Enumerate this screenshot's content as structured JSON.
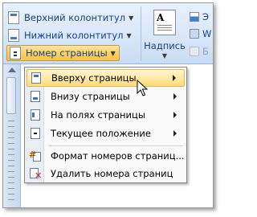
{
  "ribbon": {
    "header_button": "Верхний колонтитул",
    "footer_button": "Нижний колонтитул",
    "page_number_button": "Номер страницы",
    "textbox_label": "Надпись",
    "textbox_icon_letter": "A",
    "partial_items": [
      "Э",
      "W",
      "Б"
    ]
  },
  "menu": {
    "items": [
      {
        "label": "Вверху страницы",
        "submenu": true,
        "icon": "page-top-icon"
      },
      {
        "label": "Внизу страницы",
        "submenu": true,
        "icon": "page-bottom-icon"
      },
      {
        "label": "На полях страницы",
        "submenu": true,
        "icon": "page-margin-icon"
      },
      {
        "label": "Текущее положение",
        "submenu": true,
        "icon": "page-current-icon"
      },
      {
        "label": "Формат номеров страниц...",
        "submenu": false,
        "icon": "format-page-numbers-icon"
      },
      {
        "label": "Удалить номера страниц",
        "submenu": false,
        "icon": "delete-page-numbers-icon"
      }
    ]
  },
  "colors": {
    "ribbon_text": "#15428b",
    "highlight": "#ffe9a8",
    "active_button": "#fbd266"
  }
}
